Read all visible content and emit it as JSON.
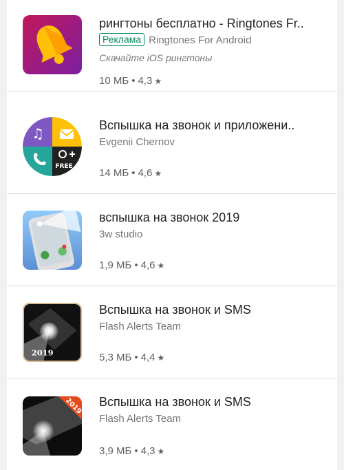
{
  "apps": [
    {
      "title": "рингтоны бесплатно - Ringtones Fr..",
      "ad_label": "Реклама",
      "developer": "Ringtones For Android",
      "promo": "Скачайте iOS рингтоны",
      "size": "10 МБ",
      "rating": "4,3",
      "icon": "bell-icon"
    },
    {
      "title": "Вспышка на звонок и приложени..",
      "developer": "Evgenii Chernov",
      "size": "14 МБ",
      "rating": "4,6",
      "icon": "quad-flash-icon",
      "icon_text": "FREE"
    },
    {
      "title": "вспышка на звонок 2019",
      "developer": "3w studio",
      "size": "1,9 МБ",
      "rating": "4,6",
      "icon": "phone-flash-icon"
    },
    {
      "title": "Вспышка на звонок и SMS",
      "developer": "Flash Alerts Team",
      "size": "5,3 МБ",
      "rating": "4,4",
      "icon": "flashlight-icon",
      "icon_text": "2019"
    },
    {
      "title": "Вспышка на звонок и SMS",
      "developer": "Flash Alerts Team",
      "size": "3,9 МБ",
      "rating": "4,3",
      "icon": "flashlight-icon",
      "icon_text": "2019"
    }
  ],
  "separator": "•",
  "star": "★",
  "colors": {
    "ad_green": "#01875f",
    "title": "#212121",
    "secondary": "#757575"
  }
}
